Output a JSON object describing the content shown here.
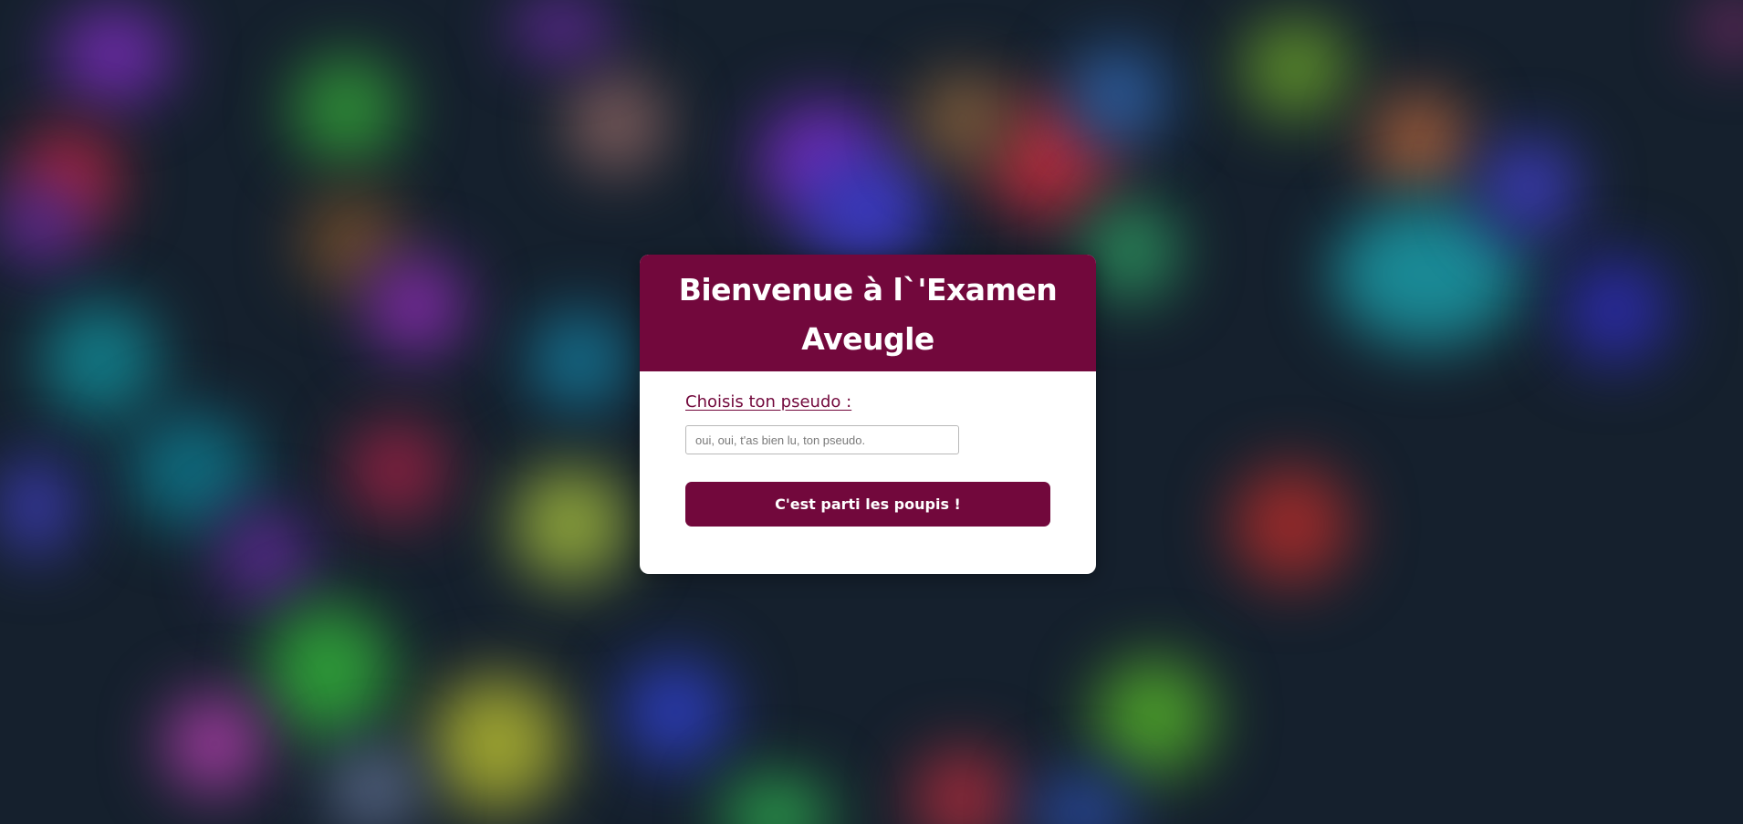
{
  "page": {
    "background_color": "#15202d",
    "accent_color": "#72083c"
  },
  "card": {
    "title": "Bienvenue à l`'Examen Aveugle",
    "label": "Choisis ton pseudo :",
    "input": {
      "value": "",
      "placeholder": "oui, oui, t'as bien lu, ton pseudo."
    },
    "button_label": "C'est parti les poupis !"
  }
}
